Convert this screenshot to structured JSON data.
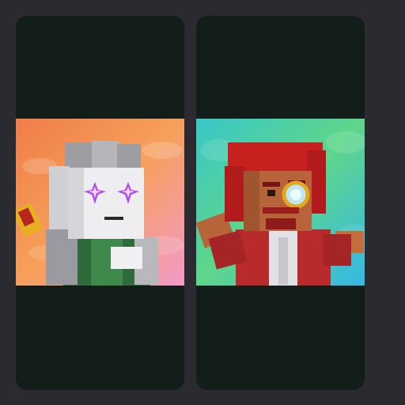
{
  "page": {
    "background": "#2b2a30",
    "card_color": "#131d19"
  },
  "cards": [
    {
      "character": "pixel-ghost-character",
      "art_background": [
        "#f07d49",
        "#f6a05b",
        "#f29ac8"
      ],
      "caption": ""
    },
    {
      "character": "red-haired-monocle-character",
      "art_background": [
        "#38c7c8",
        "#5fd68a",
        "#34b8e6"
      ],
      "caption": ""
    }
  ]
}
